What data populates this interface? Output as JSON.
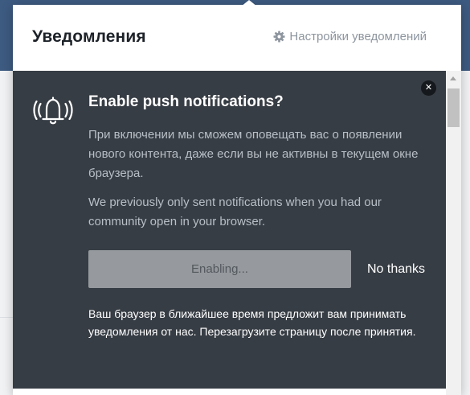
{
  "header": {
    "title": "Уведомления",
    "settings_label": "Настройки уведомлений",
    "settings_icon": "gear-icon"
  },
  "prompt": {
    "icon": "bell-ringing-icon",
    "close_icon": "close-icon",
    "title": "Enable push notifications?",
    "description": "При включении мы сможем оповещать вас о появлении нового контента, даже если вы не активны в текущем окне браузера.",
    "previous_note": "We previously only sent notifications when you had our community open in your browser.",
    "enable_button_label": "Enabling...",
    "dismiss_label": "No thanks",
    "browser_note": "Ваш браузер в ближайшее время предложит вам принимать уведомления от нас. Перезагрузите страницу после принятия."
  },
  "colors": {
    "brand_blue": "#3d5a80",
    "prompt_background": "#373d44",
    "button_disabled": "#969a9e"
  }
}
